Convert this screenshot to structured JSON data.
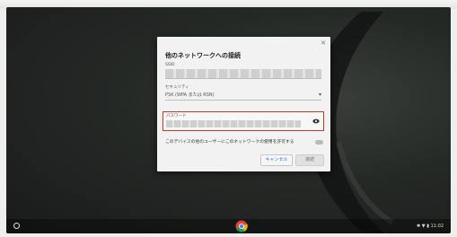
{
  "dialog": {
    "title": "他のネットワークへの接続",
    "close_icon": "close-icon",
    "ssid_label": "SSID",
    "ssid_value": "",
    "security_label": "セキュリティ",
    "security_value": "PSK (WPA または RSN)",
    "password_label": "パスワード",
    "password_value": "",
    "share_label": "このデバイスの他のユーザーにこのネットワークの使用を許可する",
    "cancel_label": "キャンセル",
    "connect_label": "接続"
  },
  "shelf": {
    "launcher_icon": "launcher-icon",
    "app_icon": "chrome-icon",
    "tray_text": "✱ ▼ ▮ 11:02"
  },
  "colors": {
    "highlight": "#c0392b",
    "accent": "#1a73e8"
  }
}
